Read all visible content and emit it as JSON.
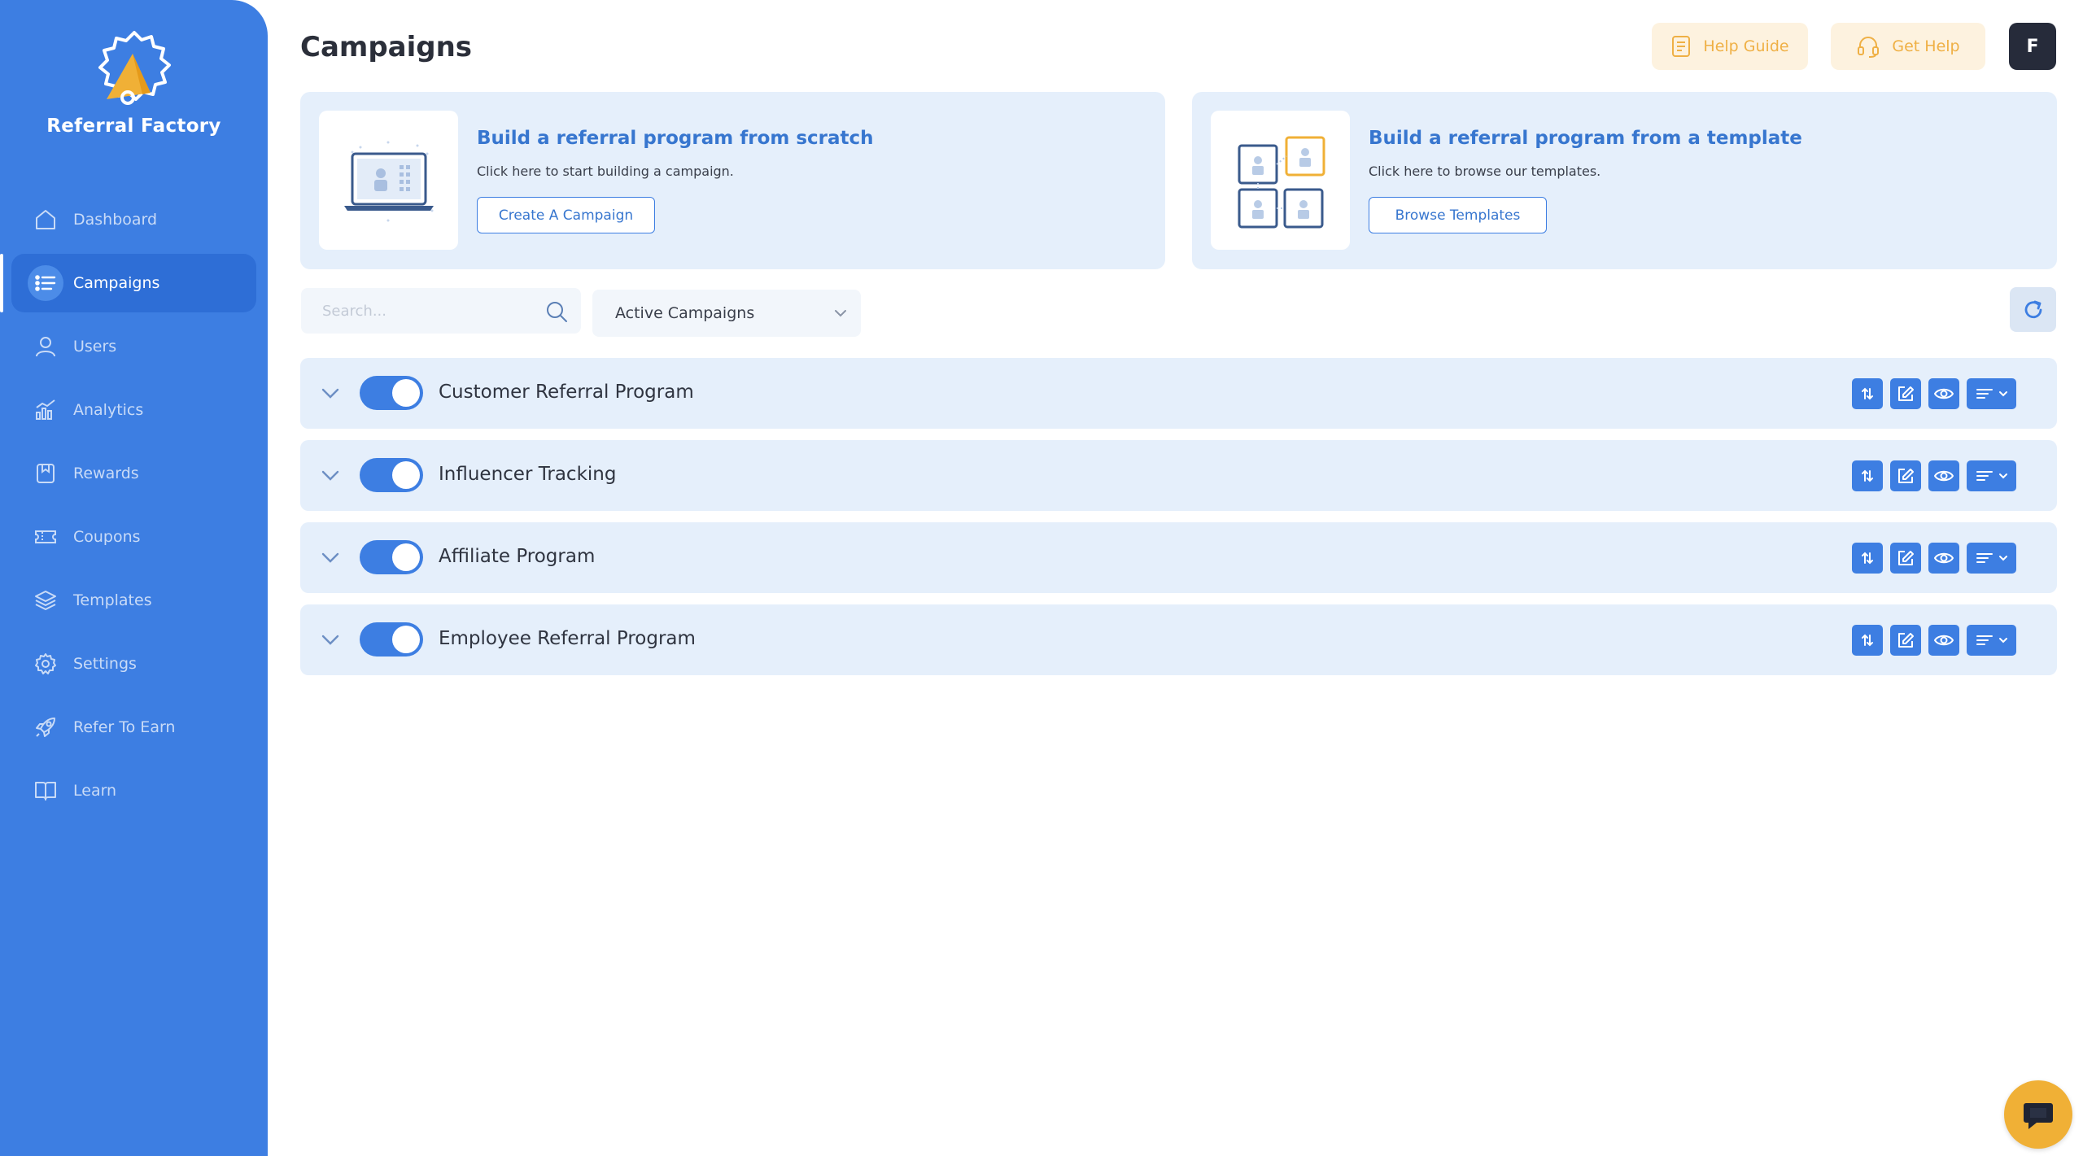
{
  "brand": {
    "name": "Referral Factory"
  },
  "sidebar": {
    "items": [
      {
        "label": "Dashboard",
        "icon": "home-icon",
        "active": false
      },
      {
        "label": "Campaigns",
        "icon": "list-icon",
        "active": true
      },
      {
        "label": "Users",
        "icon": "users-icon",
        "active": false
      },
      {
        "label": "Analytics",
        "icon": "chart-icon",
        "active": false
      },
      {
        "label": "Rewards",
        "icon": "reward-icon",
        "active": false
      },
      {
        "label": "Coupons",
        "icon": "ticket-icon",
        "active": false
      },
      {
        "label": "Templates",
        "icon": "layers-icon",
        "active": false
      },
      {
        "label": "Settings",
        "icon": "gear-icon",
        "active": false
      },
      {
        "label": "Refer To Earn",
        "icon": "rocket-icon",
        "active": false
      },
      {
        "label": "Learn",
        "icon": "book-icon",
        "active": false
      }
    ]
  },
  "header": {
    "title": "Campaigns",
    "help_guide_label": "Help Guide",
    "get_help_label": "Get Help",
    "avatar_initial": "F"
  },
  "promos": {
    "scratch": {
      "title": "Build a referral program from scratch",
      "subtitle": "Click here to start building a campaign.",
      "button": "Create A Campaign"
    },
    "template": {
      "title": "Build a referral program from a template",
      "subtitle": "Click here to browse our templates.",
      "button": "Browse Templates"
    }
  },
  "filters": {
    "search_placeholder": "Search...",
    "status_selected": "Active Campaigns"
  },
  "campaigns": [
    {
      "name": "Customer Referral Program",
      "enabled": true
    },
    {
      "name": "Influencer Tracking",
      "enabled": true
    },
    {
      "name": "Affiliate Program",
      "enabled": true
    },
    {
      "name": "Employee Referral Program",
      "enabled": true
    }
  ],
  "colors": {
    "sidebar": "#3d7ee2",
    "accent": "#3d7ee2",
    "card_bg": "#e5effb",
    "help_bg": "#fdf2df",
    "help_text": "#efb045",
    "avatar_bg": "#262b3a",
    "chat": "#f0b036"
  }
}
